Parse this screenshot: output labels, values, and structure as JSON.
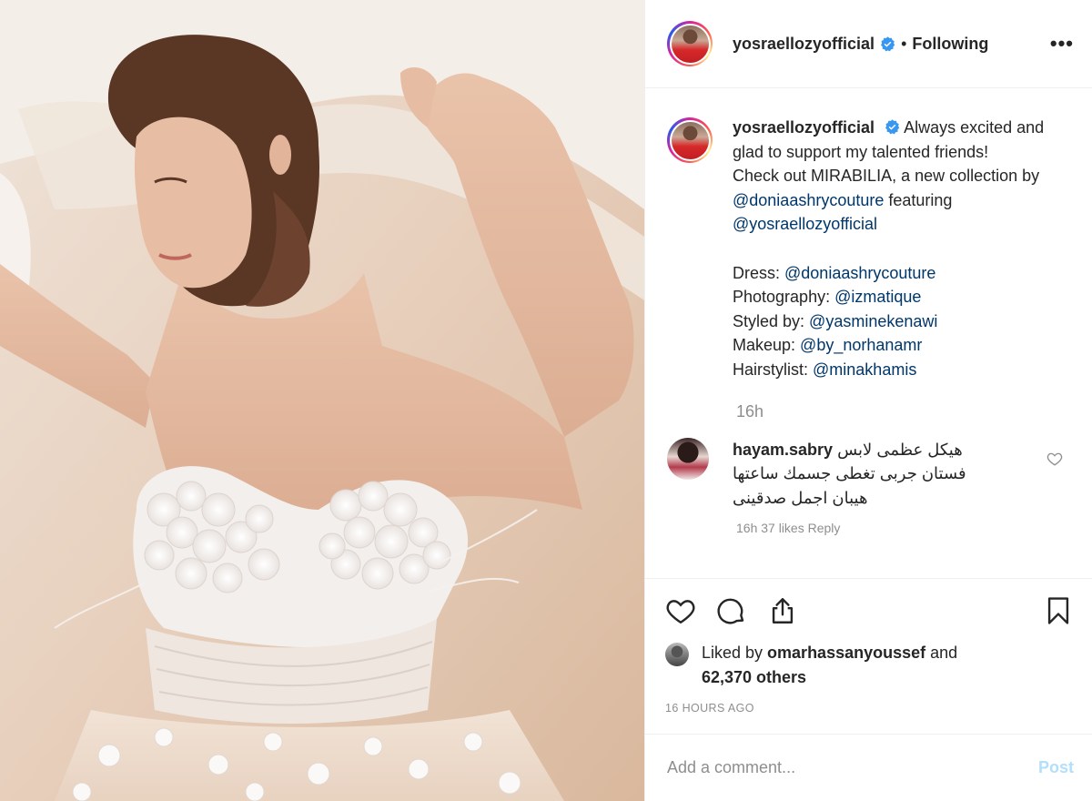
{
  "post": {
    "image_alt": "Woman in white strapless floral gown with raised arms",
    "author": "yosraellozyofficial",
    "status": "Following",
    "more_icon": "•••"
  },
  "caption": {
    "username": "yosraellozyofficial",
    "text1": "Always excited and glad to support my talented friends!",
    "text2": "Check out MIRABILIA, a new collection by ",
    "mention1": "@doniaashrycouture",
    "text3": " featuring ",
    "mention2": "@yosraellozyofficial",
    "credits": [
      {
        "label": "Dress: ",
        "handle": "@doniaashrycouture"
      },
      {
        "label": "Photography: ",
        "handle": "@izmatique"
      },
      {
        "label": "Styled by: ",
        "handle": "@yasminekenawi"
      },
      {
        "label": "Makeup: ",
        "handle": "@by_norhanamr"
      },
      {
        "label": "Hairstylist: ",
        "handle": "@minakhamis"
      }
    ],
    "time": "16h"
  },
  "comment": {
    "username": "hayam.sabry",
    "line1": "هيكل عظمى لابس",
    "line2": "فستان جربى تغطى جسمك ساعتها",
    "line3": "هيبان اجمل صدقينى",
    "meta": "16h   37 likes   Reply"
  },
  "likes": {
    "prefix": "Liked by ",
    "user": "omarhassanyoussef",
    "mid": " and",
    "count": "62,370 others"
  },
  "posted_ago": "16 HOURS AGO",
  "add_comment": {
    "placeholder": "Add a comment...",
    "post_label": "Post"
  },
  "colors": {
    "link": "#00376b",
    "verified": "#3897f0",
    "post_disabled": "#b2dffc"
  }
}
